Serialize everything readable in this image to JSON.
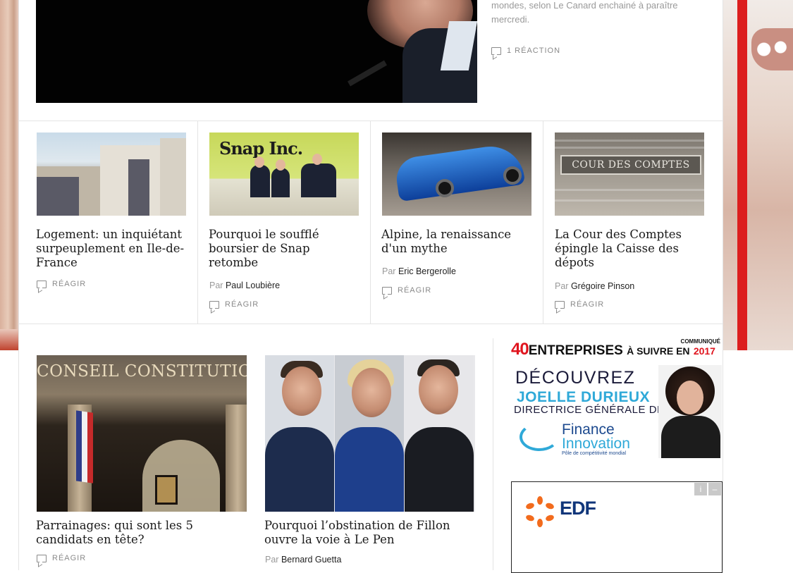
{
  "hero": {
    "excerpt": "mondes, selon Le Canard enchainé à paraître mercredi.",
    "reactions": "1 RÉACTION"
  },
  "articles": [
    {
      "title": "Logement: un inquiétant surpeuplement en Ile-de-France",
      "by": "",
      "author": "",
      "react": "RÉAGIR"
    },
    {
      "title": "Pourquoi le soufflé boursier de Snap retombe",
      "by": "Par",
      "author": "Paul Loubière",
      "react": "RÉAGIR"
    },
    {
      "title": "Alpine, la renaissance d'un mythe",
      "by": "Par",
      "author": "Eric Bergerolle",
      "react": "RÉAGIR"
    },
    {
      "title": "La Cour des Comptes épingle la Caisse des dépots",
      "by": "Par",
      "author": "Grégoire Pinson",
      "react": "RÉAGIR"
    }
  ],
  "thumbs": {
    "snap_logo": "Snap Inc.",
    "cour_plaque": "COUR DES COMPTES",
    "conseil_sign": "CONSEIL CONSTITUTION"
  },
  "features": [
    {
      "title": "Parrainages: qui sont les 5 candidats en tête?",
      "react": "RÉAGIR"
    },
    {
      "title": "Pourquoi l’obstination de Fillon ouvre la voie à Le Pen",
      "by": "Par",
      "author": "Bernard Guetta"
    }
  ],
  "ad_entreprises": {
    "number": "40",
    "word": "ENTREPRISES",
    "suffix": "À SUIVRE EN",
    "year": "2017",
    "communique": "COMMUNIQUÉ",
    "discover": "DÉCOUVREZ",
    "name": "JOELLE DURIEUX",
    "role": "DIRECTRICE GÉNÉRALE DE",
    "brand_line1": "Finance",
    "brand_line2": "Innovation",
    "brand_tagline": "Pôle de compétitivité mondial"
  },
  "ad_edf": {
    "brand": "EDF",
    "info_icon": "info-icon",
    "close_icon": "minimize-icon"
  },
  "colors": {
    "accent_red": "#e0141e",
    "edf_blue": "#10367a",
    "edf_orange": "#f26b1d",
    "fi_cyan": "#2fa9d8"
  }
}
